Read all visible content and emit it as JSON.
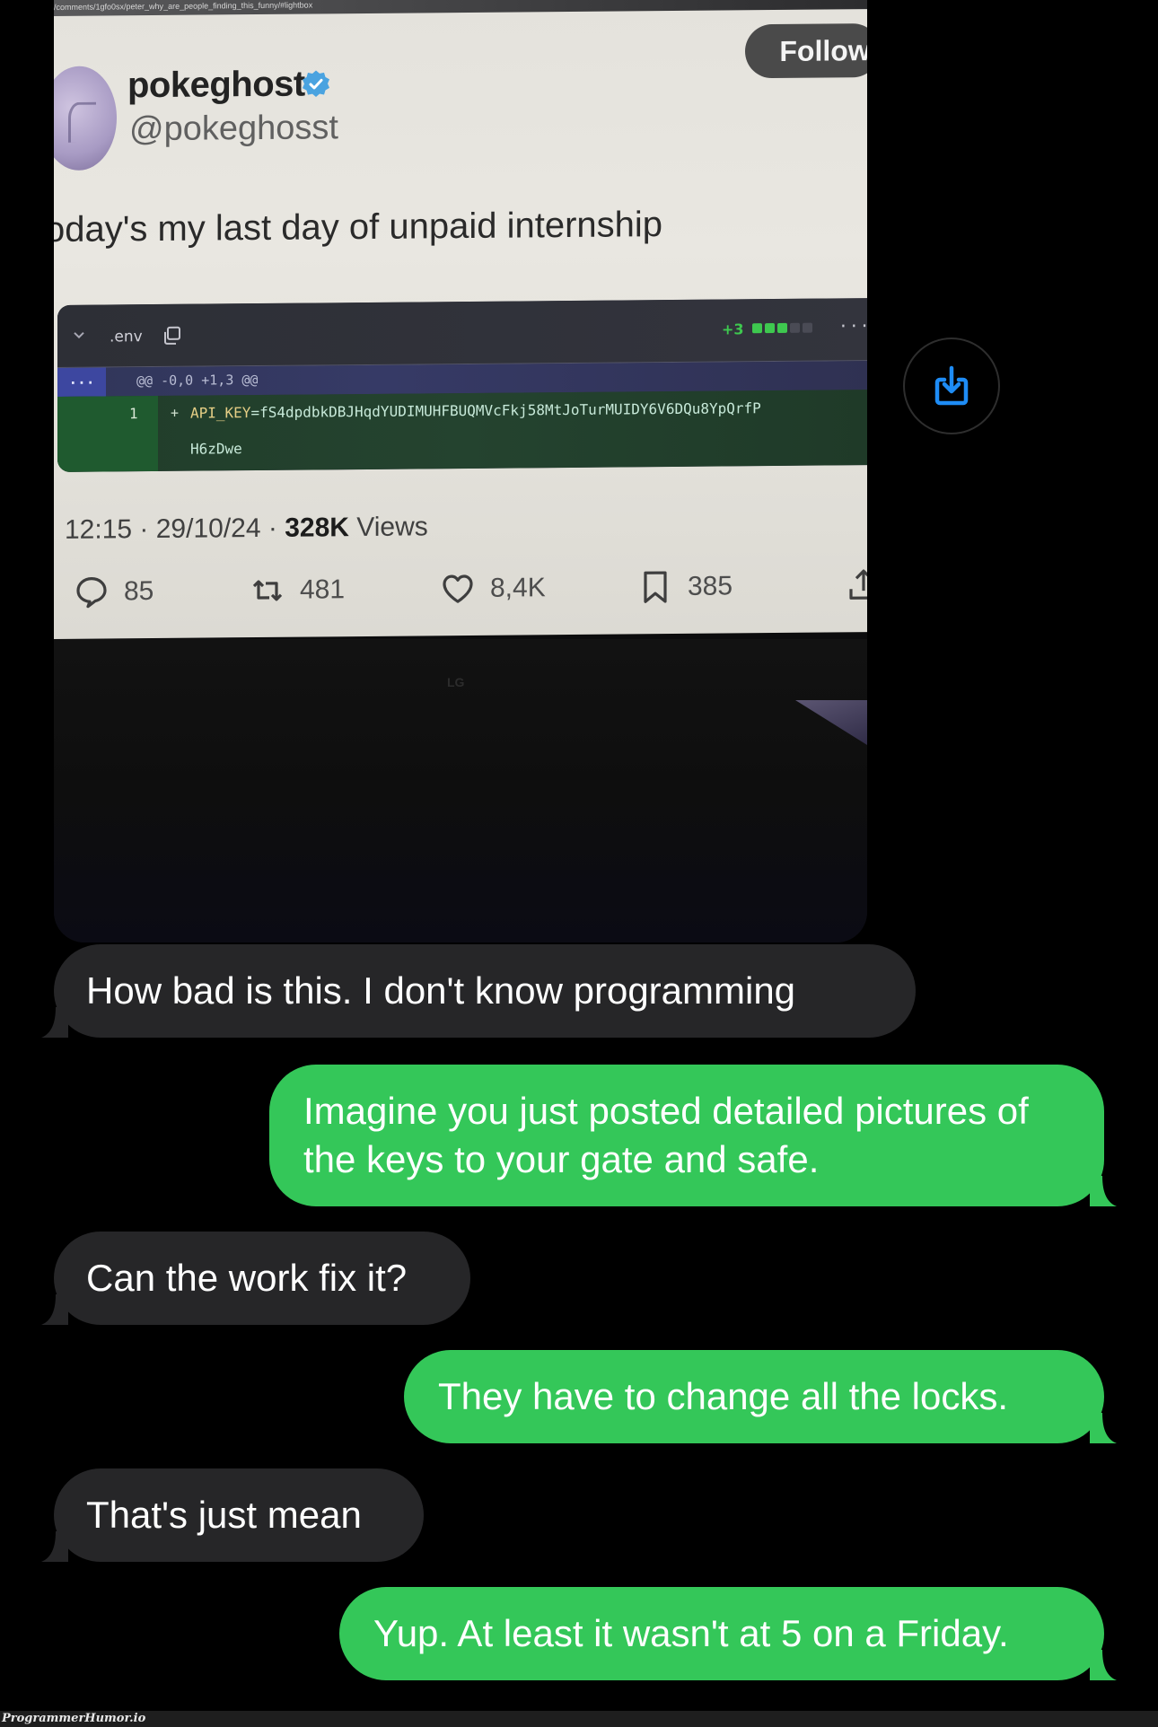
{
  "photo": {
    "browser_url": "/comments/1gfo0sx/peter_why_are_people_finding_this_funny/#lightbox",
    "tweet": {
      "display_name": "pokeghost",
      "verified": true,
      "handle": "@pokeghosst",
      "follow_label": "Follow",
      "text": "oday's my last day of unpaid internship",
      "diff": {
        "filename": ".env",
        "additions_label": "+3",
        "addition_blocks": {
          "filled": 3,
          "total": 5
        },
        "hunk_expand": "...",
        "hunk_header": "@@ -0,0 +1,3 @@",
        "line_number": "1",
        "line_sign": "+",
        "key_name": "API_KEY",
        "key_value": "=fS4dpdbkDBJHqdYUDIMUHFBUQMVcFkj58MtJoTurMUIDY6V6DQu8YpQrfP",
        "key_value_cont": "H6zDwe",
        "more_label": "..."
      },
      "time": "12:15",
      "date": "29/10/24",
      "views_count": "328K",
      "views_label": "Views",
      "stats": {
        "replies": "85",
        "reposts": "481",
        "likes": "8,4K",
        "bookmarks": "385"
      }
    },
    "monitor_logo": "LG"
  },
  "save_button": {
    "icon": "save-to-device-icon",
    "color": "#1e8cf5"
  },
  "messages": [
    {
      "direction": "incoming",
      "text": "How bad is this. I don't know programming"
    },
    {
      "direction": "outgoing",
      "text": "Imagine you just posted detailed pictures of the keys to your gate and safe."
    },
    {
      "direction": "incoming",
      "text": "Can the work fix it?"
    },
    {
      "direction": "outgoing",
      "text": "They have to change all the locks."
    },
    {
      "direction": "incoming",
      "text": "That's just mean"
    },
    {
      "direction": "outgoing",
      "text": "Yup. At least it wasn't at 5 on a Friday."
    }
  ],
  "colors": {
    "incoming_bubble": "#262628",
    "outgoing_bubble": "#34c759",
    "background": "#000000"
  },
  "watermark": "ProgrammerHumor.io"
}
